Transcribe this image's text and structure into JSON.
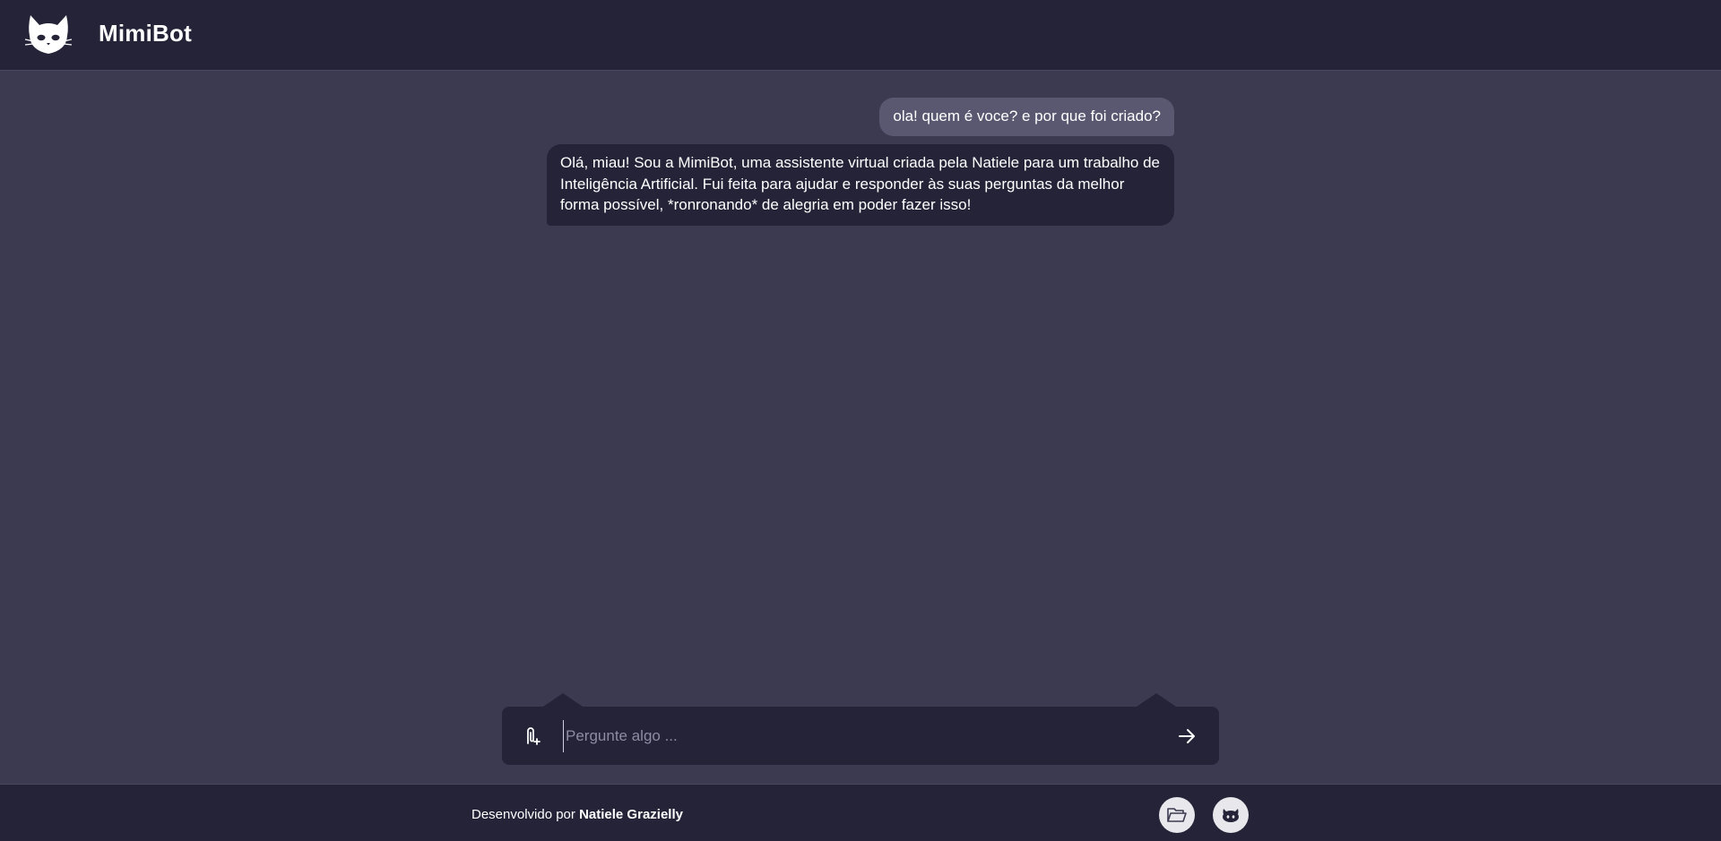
{
  "header": {
    "title": "MimiBot",
    "logo_icon": "cat-face-icon"
  },
  "chat": {
    "messages": [
      {
        "role": "user",
        "text": "ola! quem é voce? e por que foi criado?"
      },
      {
        "role": "bot",
        "text": "Olá, miau! Sou a MimiBot, uma assistente virtual criada pela Natiele para um trabalho de Inteligência Artificial. Fui feita para ajudar e responder às suas perguntas da melhor forma possível, *ronronando* de alegria em poder fazer isso!"
      }
    ]
  },
  "composer": {
    "placeholder": "Pergunte algo ...",
    "value": "",
    "attach_icon": "paperclip-plus-icon",
    "send_icon": "arrow-right-icon"
  },
  "footer": {
    "credit_prefix": "Desenvolvido por",
    "credit_name": "Natiele Grazielly",
    "portfolio_icon": "folder-open-icon",
    "github_icon": "github-icon"
  },
  "colors": {
    "background": "#3c3a50",
    "surface": "#252338",
    "user_bubble": "#5a5770",
    "text": "#ffffff"
  }
}
